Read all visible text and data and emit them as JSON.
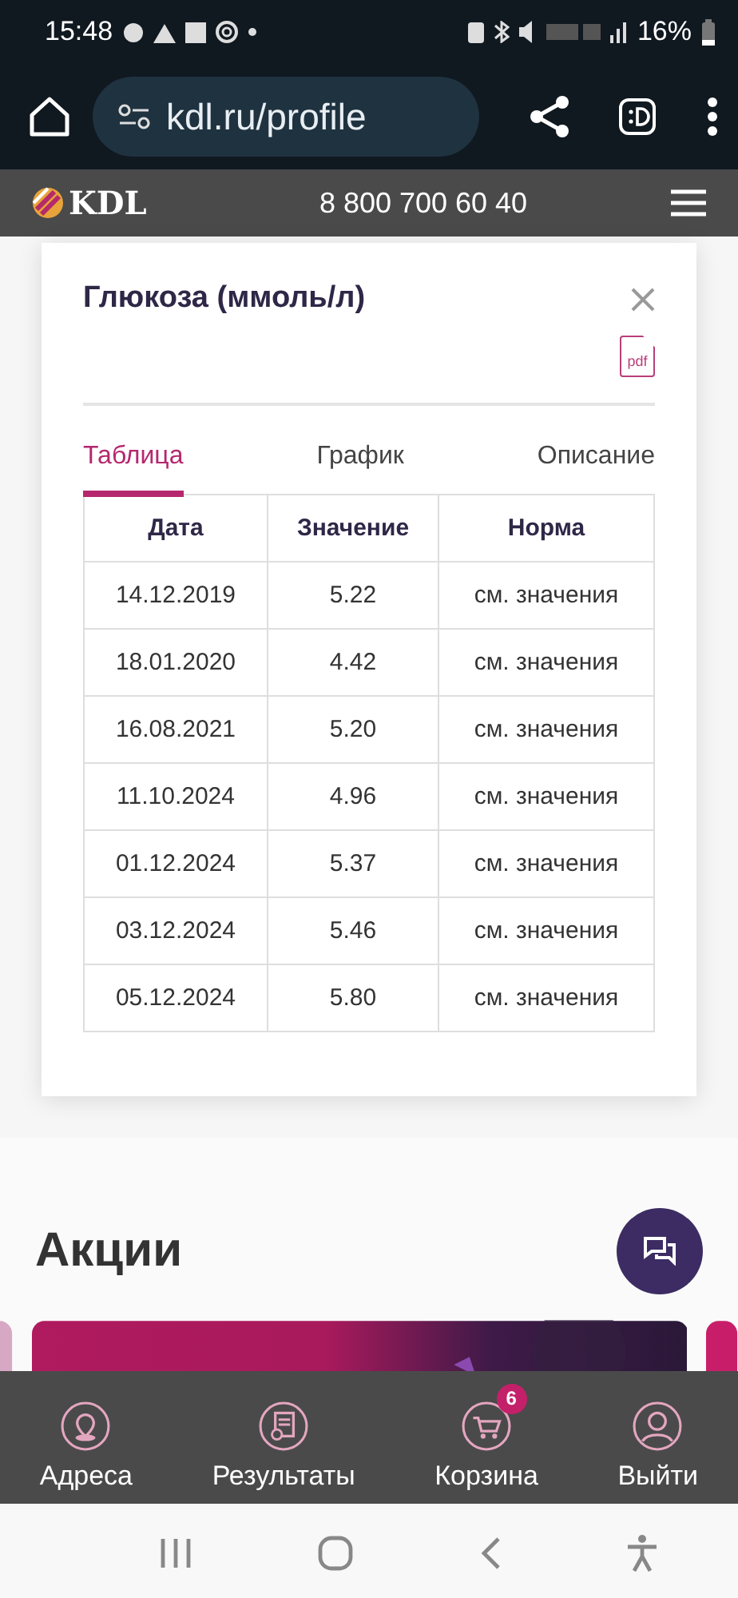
{
  "status_bar": {
    "time": "15:48",
    "battery": "16%"
  },
  "browser": {
    "url": "kdl.ru/profile"
  },
  "site_header": {
    "logo": "KDL",
    "phone": "8 800 700 60 40"
  },
  "result_card": {
    "title": "Глюкоза (ммоль/л)",
    "pdf_label": "pdf",
    "tabs": [
      {
        "label": "Таблица",
        "selected": true
      },
      {
        "label": "График",
        "selected": false
      },
      {
        "label": "Описание",
        "selected": false
      }
    ],
    "table": {
      "columns": [
        "Дата",
        "Значение",
        "Норма"
      ],
      "rows": [
        [
          "14.12.2019",
          "5.22",
          "см. значения"
        ],
        [
          "18.01.2020",
          "4.42",
          "см. значения"
        ],
        [
          "16.08.2021",
          "5.20",
          "см. значения"
        ],
        [
          "11.10.2024",
          "4.96",
          "см. значения"
        ],
        [
          "01.12.2024",
          "5.37",
          "см. значения"
        ],
        [
          "03.12.2024",
          "5.46",
          "см. значения"
        ],
        [
          "05.12.2024",
          "5.80",
          "см. значения"
        ]
      ]
    }
  },
  "promotions": {
    "title": "Акции"
  },
  "bottom_nav": [
    {
      "label": "Адреса",
      "kind": "pin"
    },
    {
      "label": "Результаты",
      "kind": "results"
    },
    {
      "label": "Корзина",
      "kind": "cart",
      "badge": "6"
    },
    {
      "label": "Выйти",
      "kind": "user"
    }
  ]
}
